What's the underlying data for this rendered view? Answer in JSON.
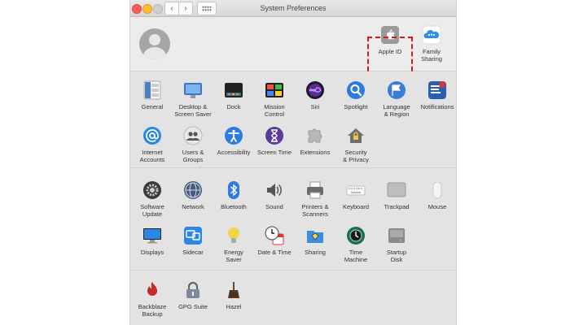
{
  "window": {
    "title": "System Preferences"
  },
  "nav": {
    "back": "‹",
    "forward": "›"
  },
  "top_panes": [
    {
      "id": "apple-id",
      "label": "Apple ID",
      "icon": "apple-logo-icon",
      "color": "#9a9a9a"
    },
    {
      "id": "family-sharing",
      "label": "Family\nSharing",
      "icon": "family-cloud-icon",
      "color": "#2c8ef2"
    }
  ],
  "section1": [
    {
      "id": "general",
      "label": "General",
      "icon": "general-icon",
      "color": "#4a7fc1"
    },
    {
      "id": "desktop",
      "label": "Desktop &\nScreen Saver",
      "icon": "desktop-icon",
      "color": "#3a76d0"
    },
    {
      "id": "dock",
      "label": "Dock",
      "icon": "dock-icon",
      "color": "#222222"
    },
    {
      "id": "mission-control",
      "label": "Mission\nControl",
      "icon": "mission-control-icon",
      "color": "#222222"
    },
    {
      "id": "siri",
      "label": "Siri",
      "icon": "siri-icon",
      "color": "#5b2b8f"
    },
    {
      "id": "spotlight",
      "label": "Spotlight",
      "icon": "magnifier-icon",
      "color": "#2d7be0"
    },
    {
      "id": "language",
      "label": "Language\n& Region",
      "icon": "flag-icon",
      "color": "#3a7dd8"
    },
    {
      "id": "notifications",
      "label": "Notifications",
      "icon": "notifications-icon",
      "color": "#d23a3a"
    },
    {
      "id": "internet-accounts",
      "label": "Internet\nAccounts",
      "icon": "at-sign-icon",
      "color": "#2b86e6"
    },
    {
      "id": "users-groups",
      "label": "Users &\nGroups",
      "icon": "users-icon",
      "color": "#8c8c8c"
    },
    {
      "id": "accessibility",
      "label": "Accessibility",
      "icon": "accessibility-icon",
      "color": "#2d7be0"
    },
    {
      "id": "screen-time",
      "label": "Screen Time",
      "icon": "hourglass-icon",
      "color": "#5a3a9a"
    },
    {
      "id": "extensions",
      "label": "Extensions",
      "icon": "puzzle-icon",
      "color": "#b8b8b8"
    },
    {
      "id": "security",
      "label": "Security\n& Privacy",
      "icon": "house-lock-icon",
      "color": "#6e6e6e"
    }
  ],
  "section2": [
    {
      "id": "software-update",
      "label": "Software\nUpdate",
      "icon": "gear-icon",
      "color": "#6a6a6a"
    },
    {
      "id": "network",
      "label": "Network",
      "icon": "globe-icon",
      "color": "#4a5a7a"
    },
    {
      "id": "bluetooth",
      "label": "Bluetooth",
      "icon": "bluetooth-icon",
      "color": "#2d7be0"
    },
    {
      "id": "sound",
      "label": "Sound",
      "icon": "speaker-icon",
      "color": "#555555"
    },
    {
      "id": "printers",
      "label": "Printers &\nScanners",
      "icon": "printer-icon",
      "color": "#6a6a6a"
    },
    {
      "id": "keyboard",
      "label": "Keyboard",
      "icon": "keyboard-icon",
      "color": "#bdbdbd"
    },
    {
      "id": "trackpad",
      "label": "Trackpad",
      "icon": "trackpad-icon",
      "color": "#bdbdbd"
    },
    {
      "id": "mouse",
      "label": "Mouse",
      "icon": "mouse-icon",
      "color": "#f4f4f4"
    },
    {
      "id": "displays",
      "label": "Displays",
      "icon": "display-icon",
      "color": "#2b86e6"
    },
    {
      "id": "sidecar",
      "label": "Sidecar",
      "icon": "sidecar-icon",
      "color": "#2b86e6"
    },
    {
      "id": "energy-saver",
      "label": "Energy\nSaver",
      "icon": "lightbulb-icon",
      "color": "#f2d44a"
    },
    {
      "id": "date-time",
      "label": "Date & Time",
      "icon": "clock-icon",
      "color": "#e8e8e8"
    },
    {
      "id": "sharing",
      "label": "Sharing",
      "icon": "sharing-folder-icon",
      "color": "#3a8fe0"
    },
    {
      "id": "time-machine",
      "label": "Time\nMachine",
      "icon": "time-machine-icon",
      "color": "#1f6b5a"
    },
    {
      "id": "startup-disk",
      "label": "Startup\nDisk",
      "icon": "disk-icon",
      "color": "#8a8a8a"
    }
  ],
  "section3": [
    {
      "id": "backblaze",
      "label": "Backblaze\nBackup",
      "icon": "flame-icon",
      "color": "#c42a2a"
    },
    {
      "id": "gpg-suite",
      "label": "GPG Suite",
      "icon": "padlock-icon",
      "color": "#7a8a9a"
    },
    {
      "id": "hazel",
      "label": "Hazel",
      "icon": "broom-icon",
      "color": "#5a3a22"
    }
  ]
}
